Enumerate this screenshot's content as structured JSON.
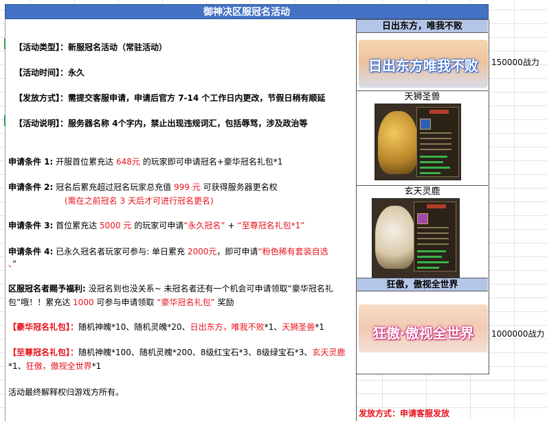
{
  "title": "御神决区服冠名活动",
  "activity_type": {
    "label": "【活动类型】：",
    "value": "新服冠名活动（常驻活动）"
  },
  "activity_time": {
    "label": "【活动时间】：",
    "value": "永久"
  },
  "issue_method": {
    "label": "【发放方式】：",
    "value": "需提交客服申请，申请后官方 7-14 个工作日内更改，节假日稍有顺延"
  },
  "activity_note": {
    "label": "【活动说明】：",
    "value": "服务器名称 4个字内，禁止出现违规词汇，包括辱骂，涉及政治等"
  },
  "cond1": {
    "label": "申请条件 1:",
    "a": "开服首位累充达",
    "amount": "648元",
    "b": "的玩家即可申请冠名+豪华冠名礼包*1"
  },
  "cond2": {
    "label": "申请条件 2:",
    "a": "冠名后累充超过冠名玩家总充值",
    "amount": "999 元",
    "b": "可获得服务器更名权",
    "note": "(需在之前冠名 3 天后才可进行冠名更名)"
  },
  "cond3": {
    "label": "申请条件 3:",
    "a": "首位累充达",
    "amount": "5000 元",
    "b": "的玩家可申请",
    "item1": "“永久冠名”",
    "plus": "+",
    "item2": "“至尊冠名礼包*1”"
  },
  "cond4": {
    "label": "申请条件 4:",
    "a": "已永久冠名者玩家可参与: 单日累充",
    "amount": "2000元",
    "b": "，即可申请",
    "item": "“粉色稀有套装自选",
    "tail1": "、",
    "tail2": "”"
  },
  "welfare": {
    "label": "区服冠名者赐予福利:",
    "a": "没冠名到也没关系~ 未冠名者还有一个机会可申请领取“豪华冠名礼包”哦！！累充达",
    "amount": "1000",
    "b": "可参与申请领取",
    "item": "“豪华冠名礼包”",
    "c": "奖励"
  },
  "luxury_pack": {
    "label": "【豪华冠名礼包】：",
    "a": "随机神魄*10、随机灵魄*20、",
    "r1": "日出东方，唯我不败",
    "b": "*1、",
    "r2": "天狮圣兽",
    "c": "*1"
  },
  "supreme_pack": {
    "label": "【至尊冠名礼包】：",
    "a": "随机神魄*100、随机灵魄*200、8级红宝石*3、8级绿宝石*3、",
    "r1": "玄天灵鹿",
    "b": "*1、",
    "r2": "狂傲，傲视全世界",
    "c": "*1"
  },
  "final_note": "活动最终解释权归游戏方所有。",
  "right": {
    "header1": "日出东方，唯我不败",
    "banner1_text": "日出东方唯我不败",
    "header2": "天狮圣兽",
    "header3": "玄天灵鹿",
    "header4": "狂傲，傲视全世界",
    "banner2_text": "狂傲·傲视全世界",
    "power1": "150000战力",
    "power2": "1000000战力"
  },
  "footer_issue": "发放方式：申请客服发放",
  "colors": {
    "title_bg": "#4472c4",
    "header_bg": "#b4c6e7",
    "highlight": "#e8121b"
  }
}
